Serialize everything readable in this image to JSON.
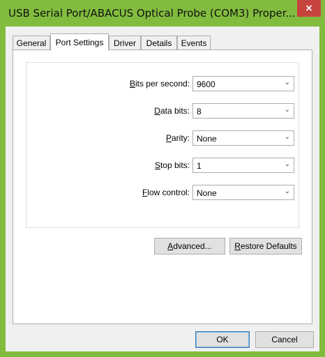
{
  "window": {
    "title": "USB Serial Port/ABACUS Optical Probe (COM3) Proper...",
    "close_glyph": "×",
    "accent_color": "#82bc3e",
    "close_color": "#c7443e"
  },
  "tabs": [
    {
      "label": "General"
    },
    {
      "label": "Port Settings",
      "active": true
    },
    {
      "label": "Driver"
    },
    {
      "label": "Details"
    },
    {
      "label": "Events"
    }
  ],
  "settings": {
    "bits_per_second": {
      "pre": "",
      "key": "B",
      "post": "its per second:",
      "value": "9600"
    },
    "data_bits": {
      "pre": "",
      "key": "D",
      "post": "ata bits:",
      "value": "8"
    },
    "parity": {
      "pre": "",
      "key": "P",
      "post": "arity:",
      "value": "None"
    },
    "stop_bits": {
      "pre": "",
      "key": "S",
      "post": "top bits:",
      "value": "1"
    },
    "flow_control": {
      "pre": "",
      "key": "F",
      "post": "low control:",
      "value": "None"
    }
  },
  "buttons": {
    "advanced": {
      "key": "A",
      "rest": "dvanced..."
    },
    "restore": {
      "key": "R",
      "rest": "estore Defaults"
    },
    "ok": "OK",
    "cancel": "Cancel"
  },
  "icons": {
    "dropdown": "chevron-down-icon",
    "close": "close-icon"
  }
}
